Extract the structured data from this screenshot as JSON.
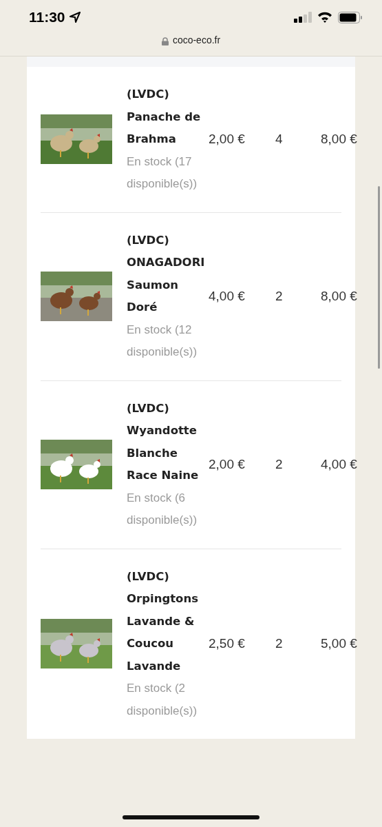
{
  "status_bar": {
    "time": "11:30"
  },
  "address_bar": {
    "url": "coco-eco.fr"
  },
  "cart_items": [
    {
      "name": "(LVDC) Panache de Brahma",
      "stock": "En stock (17 disponible(s))",
      "price": "2,00 €",
      "quantity": "4",
      "total": "8,00 €"
    },
    {
      "name": "(LVDC) ONAGADORI Saumon Doré",
      "stock": "En stock (12 disponible(s))",
      "price": "4,00 €",
      "quantity": "2",
      "total": "8,00 €"
    },
    {
      "name": "(LVDC) Wyandotte Blanche Race Naine",
      "stock": "En stock (6 disponible(s))",
      "price": "2,00 €",
      "quantity": "2",
      "total": "4,00 €"
    },
    {
      "name": "(LVDC) Orpingtons Lavande & Coucou Lavande",
      "stock": "En stock (2 disponible(s))",
      "price": "2,50 €",
      "quantity": "2",
      "total": "5,00 €"
    }
  ]
}
